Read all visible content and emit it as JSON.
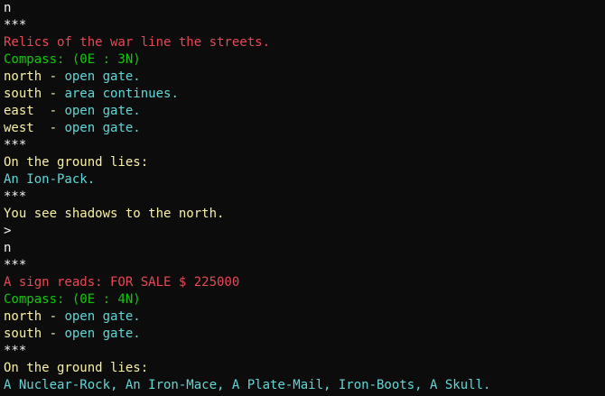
{
  "colors": {
    "background": "#0c0c0c",
    "command": "#f2f2f2",
    "description": "#e74856",
    "compass": "#16c60c",
    "label": "#f9f1a5",
    "value": "#61d6d6"
  },
  "terminal": {
    "lines": [
      {
        "segments": [
          {
            "text": "n",
            "color": "white"
          }
        ]
      },
      {
        "segments": [
          {
            "text": "***",
            "color": "white"
          }
        ]
      },
      {
        "segments": [
          {
            "text": "Relics of the war line the streets.",
            "color": "red"
          }
        ]
      },
      {
        "segments": [
          {
            "text": "Compass: (0E : 3N)",
            "color": "green"
          }
        ]
      },
      {
        "segments": [
          {
            "text": "north - ",
            "color": "yellow"
          },
          {
            "text": "open gate.",
            "color": "cyan"
          }
        ]
      },
      {
        "segments": [
          {
            "text": "south - ",
            "color": "yellow"
          },
          {
            "text": "area continues.",
            "color": "cyan"
          }
        ]
      },
      {
        "segments": [
          {
            "text": "east  - ",
            "color": "yellow"
          },
          {
            "text": "open gate.",
            "color": "cyan"
          }
        ]
      },
      {
        "segments": [
          {
            "text": "west  - ",
            "color": "yellow"
          },
          {
            "text": "open gate.",
            "color": "cyan"
          }
        ]
      },
      {
        "segments": [
          {
            "text": "***",
            "color": "white"
          }
        ]
      },
      {
        "segments": [
          {
            "text": "On the ground lies:",
            "color": "yellow"
          }
        ]
      },
      {
        "segments": [
          {
            "text": "An Ion-Pack.",
            "color": "cyan"
          }
        ]
      },
      {
        "segments": [
          {
            "text": "***",
            "color": "white"
          }
        ]
      },
      {
        "segments": [
          {
            "text": "You see shadows to the north.",
            "color": "yellow"
          }
        ]
      },
      {
        "segments": [
          {
            "text": ">",
            "color": "white"
          }
        ]
      },
      {
        "segments": [
          {
            "text": "n",
            "color": "white"
          }
        ]
      },
      {
        "segments": [
          {
            "text": "***",
            "color": "white"
          }
        ]
      },
      {
        "segments": [
          {
            "text": "A sign reads: FOR SALE $ 225000",
            "color": "red"
          }
        ]
      },
      {
        "segments": [
          {
            "text": "Compass: (0E : 4N)",
            "color": "green"
          }
        ]
      },
      {
        "segments": [
          {
            "text": "north - ",
            "color": "yellow"
          },
          {
            "text": "open gate.",
            "color": "cyan"
          }
        ]
      },
      {
        "segments": [
          {
            "text": "south - ",
            "color": "yellow"
          },
          {
            "text": "open gate.",
            "color": "cyan"
          }
        ]
      },
      {
        "segments": [
          {
            "text": "***",
            "color": "white"
          }
        ]
      },
      {
        "segments": [
          {
            "text": "On the ground lies:",
            "color": "yellow"
          }
        ]
      },
      {
        "segments": [
          {
            "text": "A Nuclear-Rock, An Iron-Mace, A Plate-Mail, Iron-Boots, A Skull.",
            "color": "cyan"
          }
        ]
      }
    ]
  }
}
